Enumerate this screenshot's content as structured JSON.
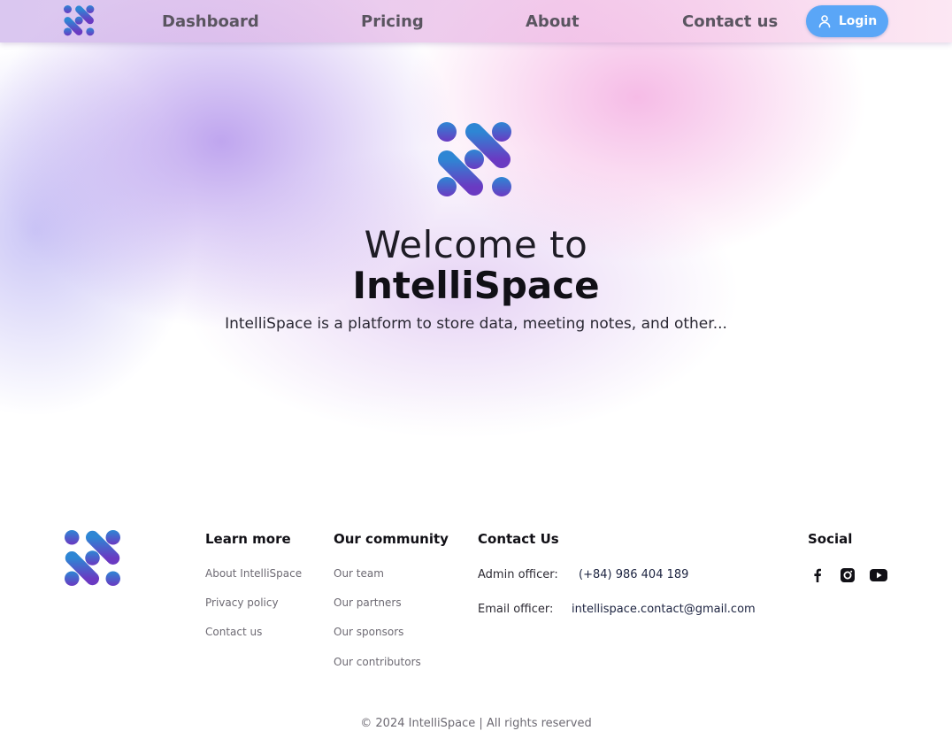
{
  "nav": {
    "links": [
      {
        "label": "Dashboard"
      },
      {
        "label": "Pricing"
      },
      {
        "label": "About"
      },
      {
        "label": "Contact us"
      }
    ],
    "login_label": "Login",
    "login_color": "#5aa6f7"
  },
  "hero": {
    "welcome": "Welcome to",
    "brand": "IntelliSpace",
    "description": "IntelliSpace is a platform to store data, meeting notes, and other..."
  },
  "footer": {
    "learn_more": {
      "heading": "Learn more",
      "links": [
        "About IntelliSpace",
        "Privacy policy",
        "Contact us"
      ]
    },
    "community": {
      "heading": "Our community",
      "links": [
        "Our team",
        "Our partners",
        "Our sponsors",
        "Our contributors"
      ]
    },
    "contact": {
      "heading": "Contact Us",
      "admin_label": "Admin officer:",
      "admin_value": "(+84) 986 404 189",
      "email_label": "Email officer:",
      "email_value": "intellispace.contact@gmail.com"
    },
    "social": {
      "heading": "Social",
      "icons": [
        "facebook-icon",
        "instagram-icon",
        "youtube-icon"
      ]
    },
    "copyright": "© 2024 IntelliSpace | All rights reserved"
  },
  "colors": {
    "brand_blue": "#2e86d4",
    "brand_purple": "#6a3ac2",
    "heading_dark": "#111016"
  }
}
